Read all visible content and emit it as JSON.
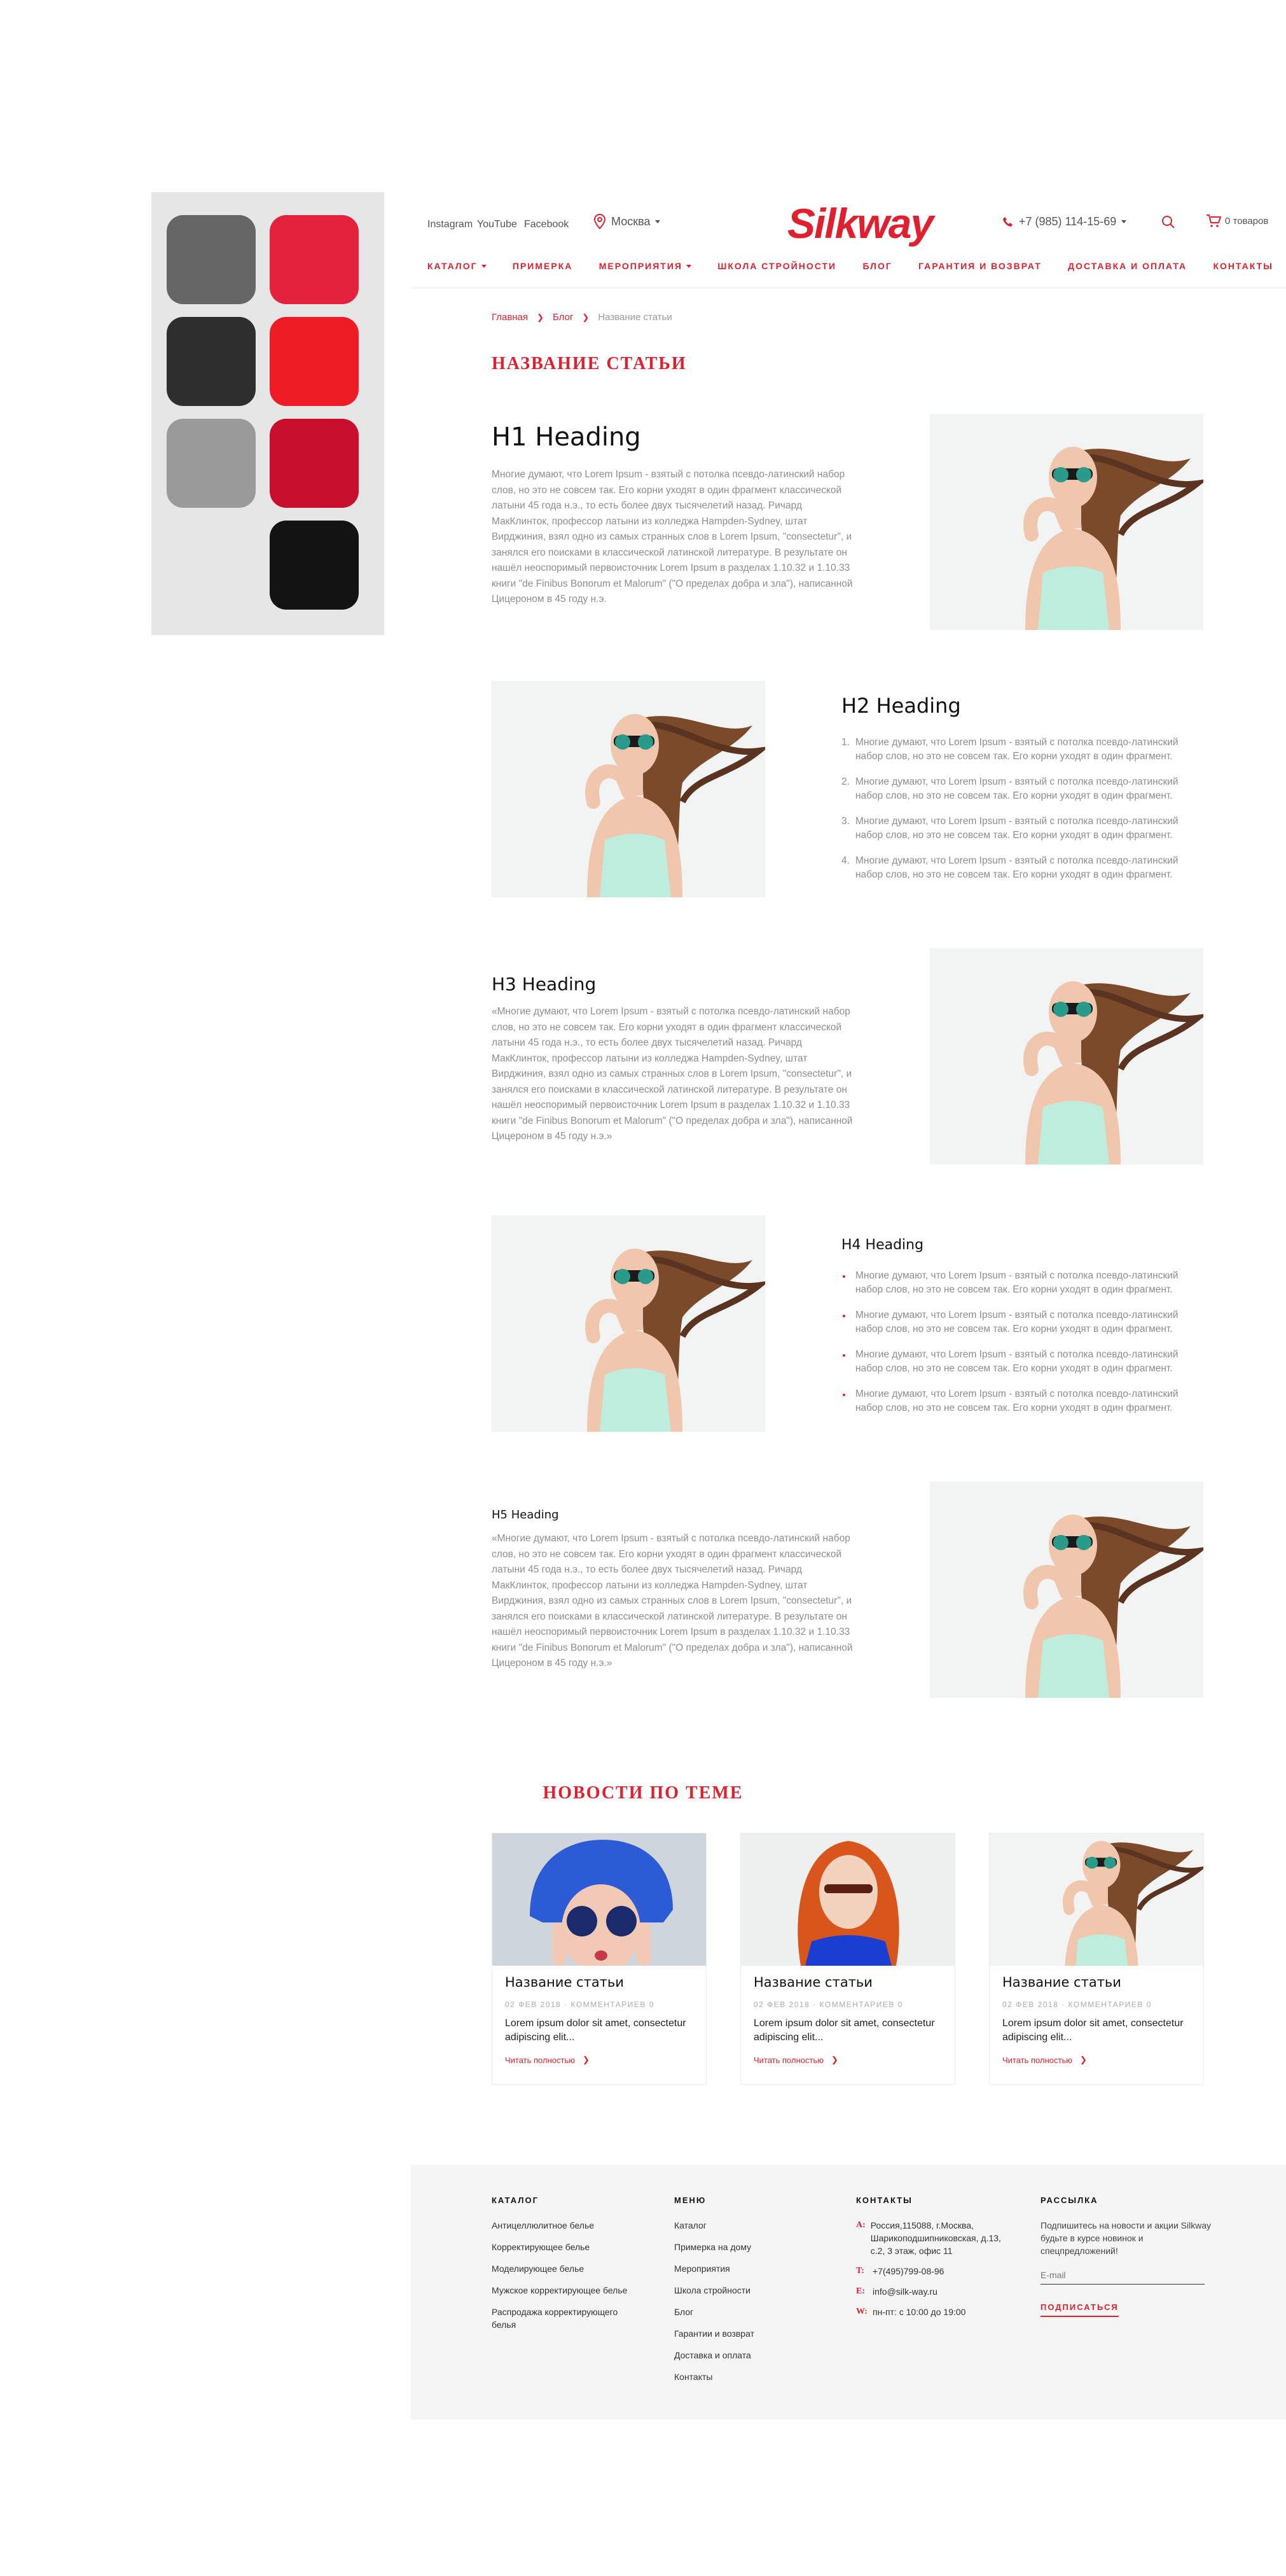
{
  "palette": {
    "colors": [
      "#666666",
      "#e3233e",
      "#2e2e2e",
      "#ee1c25",
      "#9a9a9a",
      "#c8102e",
      "#131313"
    ]
  },
  "header": {
    "social": [
      "Instagram",
      "YouTube",
      "Facebook"
    ],
    "city": "Москва",
    "logo": "Silkway",
    "phone": "+7 (985) 114-15-69",
    "cart": "0 товаров"
  },
  "nav": {
    "items": [
      {
        "label": "КАТАЛОГ",
        "dropdown": true
      },
      {
        "label": "ПРИМЕРКА",
        "dropdown": false
      },
      {
        "label": "МЕРОПРИЯТИЯ",
        "dropdown": true
      },
      {
        "label": "ШКОЛА СТРОЙНОСТИ",
        "dropdown": false
      },
      {
        "label": "БЛОГ",
        "dropdown": false
      },
      {
        "label": "ГАРАНТИЯ И ВОЗВРАТ",
        "dropdown": false
      },
      {
        "label": "ДОСТАВКА И ОПЛАТА",
        "dropdown": false
      },
      {
        "label": "КОНТАКТЫ",
        "dropdown": false
      }
    ]
  },
  "breadcrumb": {
    "home": "Главная",
    "blog": "Блог",
    "current": "Название статьи"
  },
  "page_title": "НАЗВАНИЕ СТАТЬИ",
  "sections": {
    "h1": "H1 Heading",
    "h1_text": "Многие думают, что Lorem Ipsum - взятый с потолка псевдо-латинский набор слов, но это не совсем так. Его корни уходят в один фрагмент классической латыни 45 года н.э., то есть более двух тысячелетий назад. Ричард МакКлинток, профессор латыни из колледжа Hampden-Sydney, штат Вирджиния, взял одно из самых странных слов в Lorem Ipsum, \"consectetur\", и занялся его поисками в классической латинской литературе. В результате он нашёл неоспоримый первоисточник Lorem Ipsum в разделах 1.10.32 и 1.10.33 книги \"de Finibus Bonorum et Malorum\" (\"О пределах добра и зла\"), написанной Цицероном в 45 году н.э.",
    "h2": "H2 Heading",
    "h2_items": [
      "Многие думают, что Lorem Ipsum - взятый с потолка псевдо-латинский набор слов, но это не совсем так. Его корни уходят в один фрагмент.",
      "Многие думают, что Lorem Ipsum - взятый с потолка псевдо-латинский набор слов, но это не совсем так. Его корни уходят в один фрагмент.",
      "Многие думают, что Lorem Ipsum - взятый с потолка псевдо-латинский набор слов, но это не совсем так. Его корни уходят в один фрагмент.",
      "Многие думают, что Lorem Ipsum - взятый с потолка псевдо-латинский набор слов, но это не совсем так. Его корни уходят в один фрагмент."
    ],
    "h3": "H3 Heading",
    "h3_text": "«Многие думают, что Lorem Ipsum - взятый с потолка псевдо-латинский набор слов, но это не совсем так. Его корни уходят в один фрагмент классической латыни 45 года н.э., то есть более двух тысячелетий назад. Ричард МакКлинток, профессор латыни из колледжа Hampden-Sydney, штат Вирджиния, взял одно из самых странных слов в Lorem Ipsum, \"consectetur\", и занялся его поисками в классической латинской литературе. В результате он нашёл неоспоримый первоисточник Lorem Ipsum в разделах 1.10.32 и 1.10.33 книги \"de Finibus Bonorum et Malorum\" (\"О пределах добра и зла\"), написанной Цицероном в 45 году н.э.»",
    "h4": "H4 Heading",
    "h4_items": [
      "Многие думают, что Lorem Ipsum - взятый с потолка псевдо-латинский набор слов, но это не совсем так. Его корни уходят в один фрагмент.",
      "Многие думают, что Lorem Ipsum - взятый с потолка псевдо-латинский набор слов, но это не совсем так. Его корни уходят в один фрагмент.",
      "Многие думают, что Lorem Ipsum - взятый с потолка псевдо-латинский набор слов, но это не совсем так. Его корни уходят в один фрагмент.",
      "Многие думают, что Lorem Ipsum - взятый с потолка псевдо-латинский набор слов, но это не совсем так. Его корни уходят в один фрагмент."
    ],
    "h5": "H5 Heading",
    "h5_text": "«Многие думают, что Lorem Ipsum - взятый с потолка псевдо-латинский набор слов, но это не совсем так. Его корни уходят в один фрагмент классической латыни 45 года н.э., то есть более двух тысячелетий назад. Ричард МакКлинток, профессор латыни из колледжа Hampden-Sydney, штат Вирджиния, взял одно из самых странных слов в Lorem Ipsum, \"consectetur\", и занялся его поисками в классической латинской литературе. В результате он нашёл неоспоримый первоисточник Lorem Ipsum в разделах 1.10.32 и 1.10.33 книги \"de Finibus Bonorum et Malorum\" (\"О пределах добра и зла\"), написанной Цицероном в 45 году н.э.»"
  },
  "news": {
    "title": "НОВОСТИ ПО ТЕМЕ",
    "cards": [
      {
        "title": "Название статьи",
        "meta": "02 ФЕВ 2018  ·  КОММЕНТАРИЕВ 0",
        "text": "Lorem ipsum dolor sit amet, consectetur adipiscing elit...",
        "more": "Читать полностью"
      },
      {
        "title": "Название статьи",
        "meta": "02 ФЕВ 2018  ·  КОММЕНТАРИЕВ 0",
        "text": "Lorem ipsum dolor sit amet, consectetur adipiscing elit...",
        "more": "Читать полностью"
      },
      {
        "title": "Название статьи",
        "meta": "02 ФЕВ 2018  ·  КОММЕНТАРИЕВ 0",
        "text": "Lorem ipsum dolor sit amet, consectetur adipiscing elit...",
        "more": "Читать полностью"
      }
    ]
  },
  "footer": {
    "catalog": {
      "title": "КАТАЛОГ",
      "links": [
        "Антицеллюлитное белье",
        "Корректирующее белье",
        "Моделирующее белье",
        "Мужское корректирующее белье",
        "Распродажа корректирующего белья"
      ]
    },
    "menu": {
      "title": "МЕНЮ",
      "links": [
        "Каталог",
        "Примерка на дому",
        "Мероприятия",
        "Школа стройности",
        "Блог",
        "Гарантии и возврат",
        "Доставка и оплата",
        "Контакты"
      ]
    },
    "contacts": {
      "title": "КОНТАКТЫ",
      "items": [
        {
          "label": "A:",
          "value": "Россия,115088, г.Москва, Шарикоподшипниковская, д.13, с.2, 3 этаж, офис 11"
        },
        {
          "label": "T:",
          "value": "+7(495)799-08-96"
        },
        {
          "label": "E:",
          "value": "info@silk-way.ru"
        },
        {
          "label": "W:",
          "value": "пн-пт: с 10:00 до 19:00"
        }
      ]
    },
    "newsletter": {
      "title": "РАССЫЛКА",
      "text": "Подпишитесь на новости и акции Silkway будьте в курсе новинок и спецпредложений!",
      "placeholder": "E-mail",
      "button": "ПОДПИСАТЬСЯ"
    }
  }
}
